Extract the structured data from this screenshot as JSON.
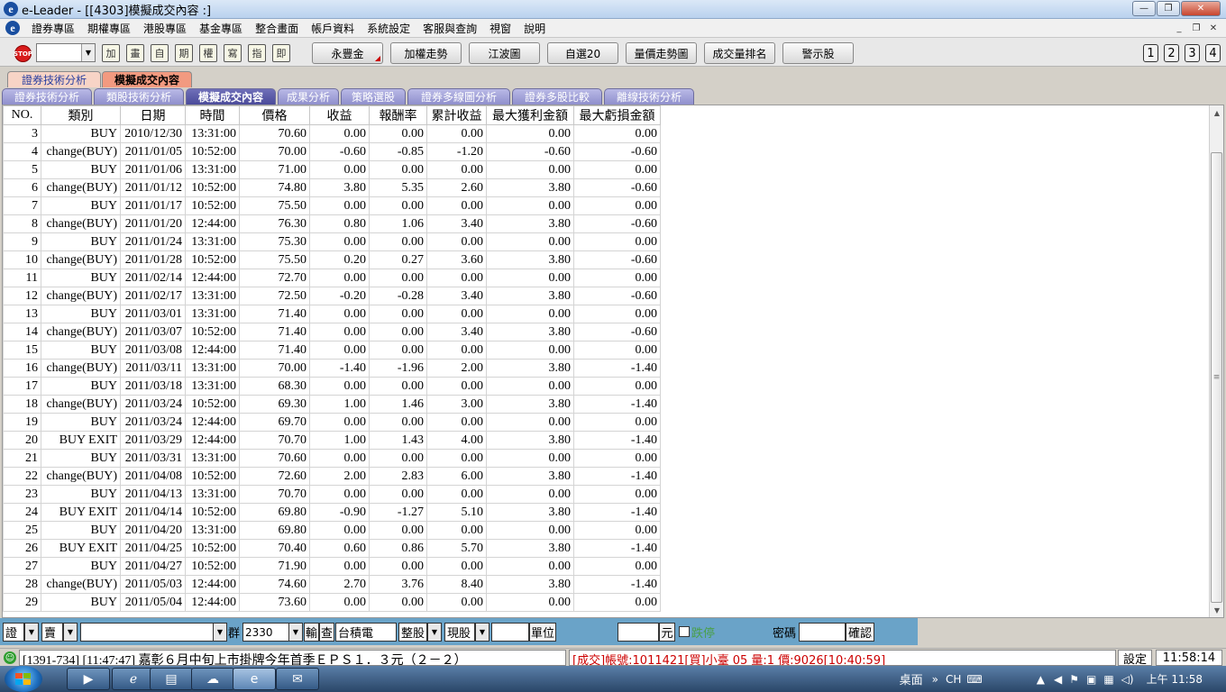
{
  "window": {
    "app_icon_letter": "e",
    "title": "e-Leader - [[4303]模擬成交內容 :]"
  },
  "menu": [
    "證券專區",
    "期權專區",
    "港股專區",
    "基金專區",
    "整合畫面",
    "帳戶資料",
    "系統設定",
    "客服與查詢",
    "視窗",
    "說明"
  ],
  "toolbar": {
    "stop_label": "STOP",
    "combo_value": "",
    "icons": [
      "加",
      "畫",
      "自",
      "期",
      "權",
      "寫",
      "指",
      "即"
    ],
    "buttons": [
      "永豐金",
      "加權走勢",
      "江波圖",
      "自選20",
      "量價走勢圖",
      "成交量排名",
      "警示股"
    ],
    "number_buttons": [
      "1",
      "2",
      "3",
      "4"
    ]
  },
  "tabs_top": [
    {
      "label": "證券技術分析",
      "active": false
    },
    {
      "label": "模擬成交內容",
      "active": true
    }
  ],
  "tabs_second": [
    {
      "label": "證券技術分析",
      "active": false
    },
    {
      "label": "類股技術分析",
      "active": false
    },
    {
      "label": "模擬成交內容",
      "active": true
    },
    {
      "label": "成果分析",
      "active": false
    },
    {
      "label": "策略選股",
      "active": false
    },
    {
      "label": "證券多線圖分析",
      "active": false
    },
    {
      "label": "證券多股比較",
      "active": false
    },
    {
      "label": "離線技術分析",
      "active": false
    }
  ],
  "table": {
    "columns": [
      "NO.",
      "類別",
      "日期",
      "時間",
      "價格",
      "收益",
      "報酬率",
      "累計收益",
      "最大獲利金額",
      "最大虧損金額"
    ],
    "rows": [
      [
        "3",
        "BUY",
        "2010/12/30",
        "13:31:00",
        "70.60",
        "0.00",
        "0.00",
        "0.00",
        "0.00",
        "0.00"
      ],
      [
        "4",
        "change(BUY)",
        "2011/01/05",
        "10:52:00",
        "70.00",
        "-0.60",
        "-0.85",
        "-1.20",
        "-0.60",
        "-0.60"
      ],
      [
        "5",
        "BUY",
        "2011/01/06",
        "13:31:00",
        "71.00",
        "0.00",
        "0.00",
        "0.00",
        "0.00",
        "0.00"
      ],
      [
        "6",
        "change(BUY)",
        "2011/01/12",
        "10:52:00",
        "74.80",
        "3.80",
        "5.35",
        "2.60",
        "3.80",
        "-0.60"
      ],
      [
        "7",
        "BUY",
        "2011/01/17",
        "10:52:00",
        "75.50",
        "0.00",
        "0.00",
        "0.00",
        "0.00",
        "0.00"
      ],
      [
        "8",
        "change(BUY)",
        "2011/01/20",
        "12:44:00",
        "76.30",
        "0.80",
        "1.06",
        "3.40",
        "3.80",
        "-0.60"
      ],
      [
        "9",
        "BUY",
        "2011/01/24",
        "13:31:00",
        "75.30",
        "0.00",
        "0.00",
        "0.00",
        "0.00",
        "0.00"
      ],
      [
        "10",
        "change(BUY)",
        "2011/01/28",
        "10:52:00",
        "75.50",
        "0.20",
        "0.27",
        "3.60",
        "3.80",
        "-0.60"
      ],
      [
        "11",
        "BUY",
        "2011/02/14",
        "12:44:00",
        "72.70",
        "0.00",
        "0.00",
        "0.00",
        "0.00",
        "0.00"
      ],
      [
        "12",
        "change(BUY)",
        "2011/02/17",
        "13:31:00",
        "72.50",
        "-0.20",
        "-0.28",
        "3.40",
        "3.80",
        "-0.60"
      ],
      [
        "13",
        "BUY",
        "2011/03/01",
        "13:31:00",
        "71.40",
        "0.00",
        "0.00",
        "0.00",
        "0.00",
        "0.00"
      ],
      [
        "14",
        "change(BUY)",
        "2011/03/07",
        "10:52:00",
        "71.40",
        "0.00",
        "0.00",
        "3.40",
        "3.80",
        "-0.60"
      ],
      [
        "15",
        "BUY",
        "2011/03/08",
        "12:44:00",
        "71.40",
        "0.00",
        "0.00",
        "0.00",
        "0.00",
        "0.00"
      ],
      [
        "16",
        "change(BUY)",
        "2011/03/11",
        "13:31:00",
        "70.00",
        "-1.40",
        "-1.96",
        "2.00",
        "3.80",
        "-1.40"
      ],
      [
        "17",
        "BUY",
        "2011/03/18",
        "13:31:00",
        "68.30",
        "0.00",
        "0.00",
        "0.00",
        "0.00",
        "0.00"
      ],
      [
        "18",
        "change(BUY)",
        "2011/03/24",
        "10:52:00",
        "69.30",
        "1.00",
        "1.46",
        "3.00",
        "3.80",
        "-1.40"
      ],
      [
        "19",
        "BUY",
        "2011/03/24",
        "12:44:00",
        "69.70",
        "0.00",
        "0.00",
        "0.00",
        "0.00",
        "0.00"
      ],
      [
        "20",
        "BUY EXIT",
        "2011/03/29",
        "12:44:00",
        "70.70",
        "1.00",
        "1.43",
        "4.00",
        "3.80",
        "-1.40"
      ],
      [
        "21",
        "BUY",
        "2011/03/31",
        "13:31:00",
        "70.60",
        "0.00",
        "0.00",
        "0.00",
        "0.00",
        "0.00"
      ],
      [
        "22",
        "change(BUY)",
        "2011/04/08",
        "10:52:00",
        "72.60",
        "2.00",
        "2.83",
        "6.00",
        "3.80",
        "-1.40"
      ],
      [
        "23",
        "BUY",
        "2011/04/13",
        "13:31:00",
        "70.70",
        "0.00",
        "0.00",
        "0.00",
        "0.00",
        "0.00"
      ],
      [
        "24",
        "BUY EXIT",
        "2011/04/14",
        "10:52:00",
        "69.80",
        "-0.90",
        "-1.27",
        "5.10",
        "3.80",
        "-1.40"
      ],
      [
        "25",
        "BUY",
        "2011/04/20",
        "13:31:00",
        "69.80",
        "0.00",
        "0.00",
        "0.00",
        "0.00",
        "0.00"
      ],
      [
        "26",
        "BUY EXIT",
        "2011/04/25",
        "10:52:00",
        "70.40",
        "0.60",
        "0.86",
        "5.70",
        "3.80",
        "-1.40"
      ],
      [
        "27",
        "BUY",
        "2011/04/27",
        "10:52:00",
        "71.90",
        "0.00",
        "0.00",
        "0.00",
        "0.00",
        "0.00"
      ],
      [
        "28",
        "change(BUY)",
        "2011/05/03",
        "12:44:00",
        "74.60",
        "2.70",
        "3.76",
        "8.40",
        "3.80",
        "-1.40"
      ],
      [
        "29",
        "BUY",
        "2011/05/04",
        "12:44:00",
        "73.60",
        "0.00",
        "0.00",
        "0.00",
        "0.00",
        "0.00"
      ]
    ]
  },
  "order": {
    "market": "證",
    "side": "賣",
    "group_label": "群",
    "stock_code": "2330",
    "lookup_label": "輸",
    "query_label": "查",
    "stock_name": "台積電",
    "lot_type": "整股",
    "trade_type": "現股",
    "unit_label": "單位",
    "yuan_label": "元",
    "suspend_label": "跌停",
    "password_label": "密碼",
    "confirm_label": "確認"
  },
  "status": {
    "news": "[1391-734] [11:47:47] 嘉彰６月中旬上市掛牌今年首季ＥＰＳ１．３元（２－２）",
    "deal": "[成交]帳號:1011421[買]小臺      05 量:1 價:9026[10:40:59]",
    "settings_label": "設定",
    "clock": "11:58:14"
  },
  "taskbar": {
    "desktop_label": "桌面",
    "lang": "CH",
    "time": "上午 11:58"
  }
}
